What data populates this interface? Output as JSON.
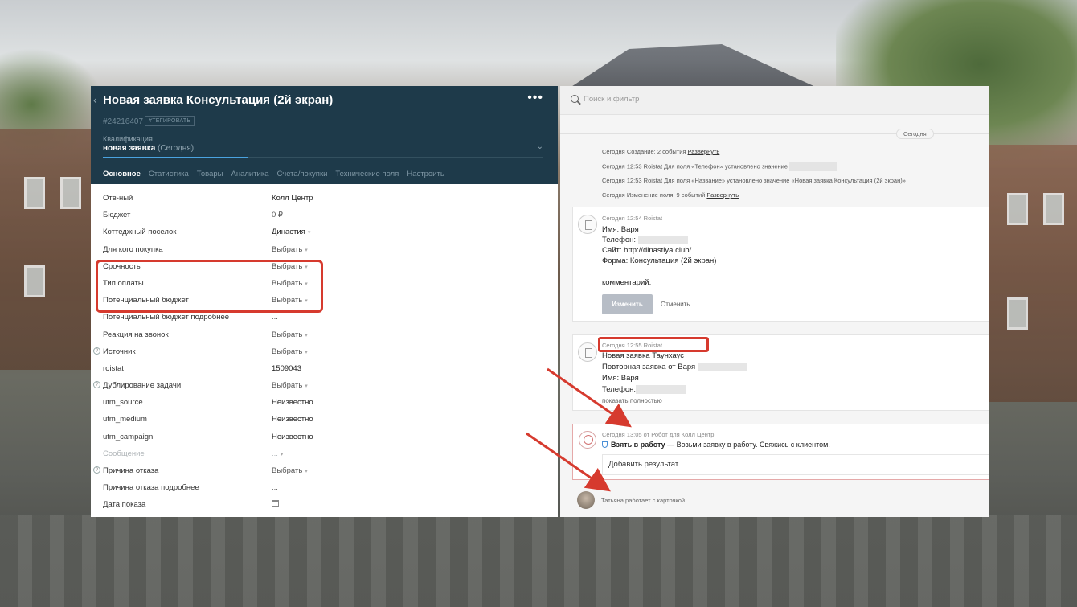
{
  "lead": {
    "title": "Новая заявка Консультация (2й экран)",
    "id": "#24216407",
    "tag_button": "#ТЕГИРОВАТЬ",
    "stage_label": "Квалификация",
    "stage_value": "новая заявка",
    "stage_date": "(Сегодня)",
    "progress_percent": 33,
    "more_icon": "more-dots-icon",
    "back_icon": "chevron-left-icon"
  },
  "tabs": [
    "Основное",
    "Статистика",
    "Товары",
    "Аналитика",
    "Счета/покупки",
    "Технические поля",
    "Настроить"
  ],
  "fields": [
    {
      "label": "Отв-ный",
      "value": "Колл Центр",
      "kind": "text"
    },
    {
      "label": "Бюджет",
      "value": "0 ₽",
      "kind": "select"
    },
    {
      "label": "Коттеджный поселок",
      "value": "Династия",
      "kind": "text",
      "caret": true
    },
    {
      "label": "Для кого покупка",
      "value": "Выбрать",
      "kind": "select",
      "caret": true
    },
    {
      "label": "Срочность",
      "value": "Выбрать",
      "kind": "select",
      "caret": true
    },
    {
      "label": "Тип оплаты",
      "value": "Выбрать",
      "kind": "select",
      "caret": true
    },
    {
      "label": "Потенциальный бюджет",
      "value": "Выбрать",
      "kind": "select",
      "caret": true
    },
    {
      "label": "Потенциальный бюджет подробнее",
      "value": "...",
      "kind": "select"
    },
    {
      "label": "Реакция на звонок",
      "value": "Выбрать",
      "kind": "select",
      "caret": true
    },
    {
      "label": "Источник",
      "value": "Выбрать",
      "kind": "select",
      "caret": true,
      "help": true
    },
    {
      "label": "roistat",
      "value": "1509043",
      "kind": "text"
    },
    {
      "label": "Дублирование задачи",
      "value": "Выбрать",
      "kind": "select",
      "caret": true,
      "help": true
    },
    {
      "label": "utm_source",
      "value": "Неизвестно",
      "kind": "text"
    },
    {
      "label": "utm_medium",
      "value": "Неизвестно",
      "kind": "text"
    },
    {
      "label": "utm_campaign",
      "value": "Неизвестно",
      "kind": "text"
    },
    {
      "label": "Сообщение",
      "value": "...",
      "kind": "muted",
      "caret": true
    },
    {
      "label": "Причина отказа",
      "value": "Выбрать",
      "kind": "select",
      "caret": true,
      "help": true
    },
    {
      "label": "Причина отказа подробнее",
      "value": "...",
      "kind": "select"
    },
    {
      "label": "Дата показа",
      "value": "",
      "kind": "calendar"
    }
  ],
  "feed": {
    "search_placeholder": "Поиск и фильтр",
    "day_label": "Сегодня",
    "system_events": [
      {
        "text": "Сегодня Создание: 2 события ",
        "link": "Развернуть"
      },
      {
        "text": "Сегодня 12:53 Roistat Для поля «Телефон» установлено значение",
        "link": ""
      },
      {
        "text": "Сегодня 12:53 Roistat Для поля «Название» установлено значение «Новая заявка Консультация (2й экран)»",
        "link": ""
      },
      {
        "text": "Сегодня Изменение поля: 9 событий ",
        "link": "Развернуть"
      }
    ],
    "note1": {
      "meta": "Сегодня 12:54 Roistat",
      "lines": [
        "Имя: Варя",
        "Телефон:",
        "Сайт: http://dinastiya.club/",
        "Форма: Консультация (2й экран)",
        "комментарий:"
      ],
      "change_button": "Изменить",
      "cancel_button": "Отменить"
    },
    "note2": {
      "meta": "Сегодня 12:55 Roistat",
      "lines": [
        "Новая заявка Таунхаус",
        "Повторная заявка от Варя",
        "Имя: Варя",
        "Телефон:"
      ],
      "show_full": "показать полностью"
    },
    "task": {
      "meta": "Сегодня 13:05 от Робот для Колл Центр",
      "title": "Взять в работу",
      "text": " — Возьми заявку в работу. Свяжись с клиентом.",
      "result_placeholder": "Добавить результат"
    },
    "presence": "Татьяна работает с карточкой"
  },
  "colors": {
    "header_bg": "#1e3a4a",
    "highlight": "#d63a2e",
    "progress": "#4aa3e0"
  }
}
